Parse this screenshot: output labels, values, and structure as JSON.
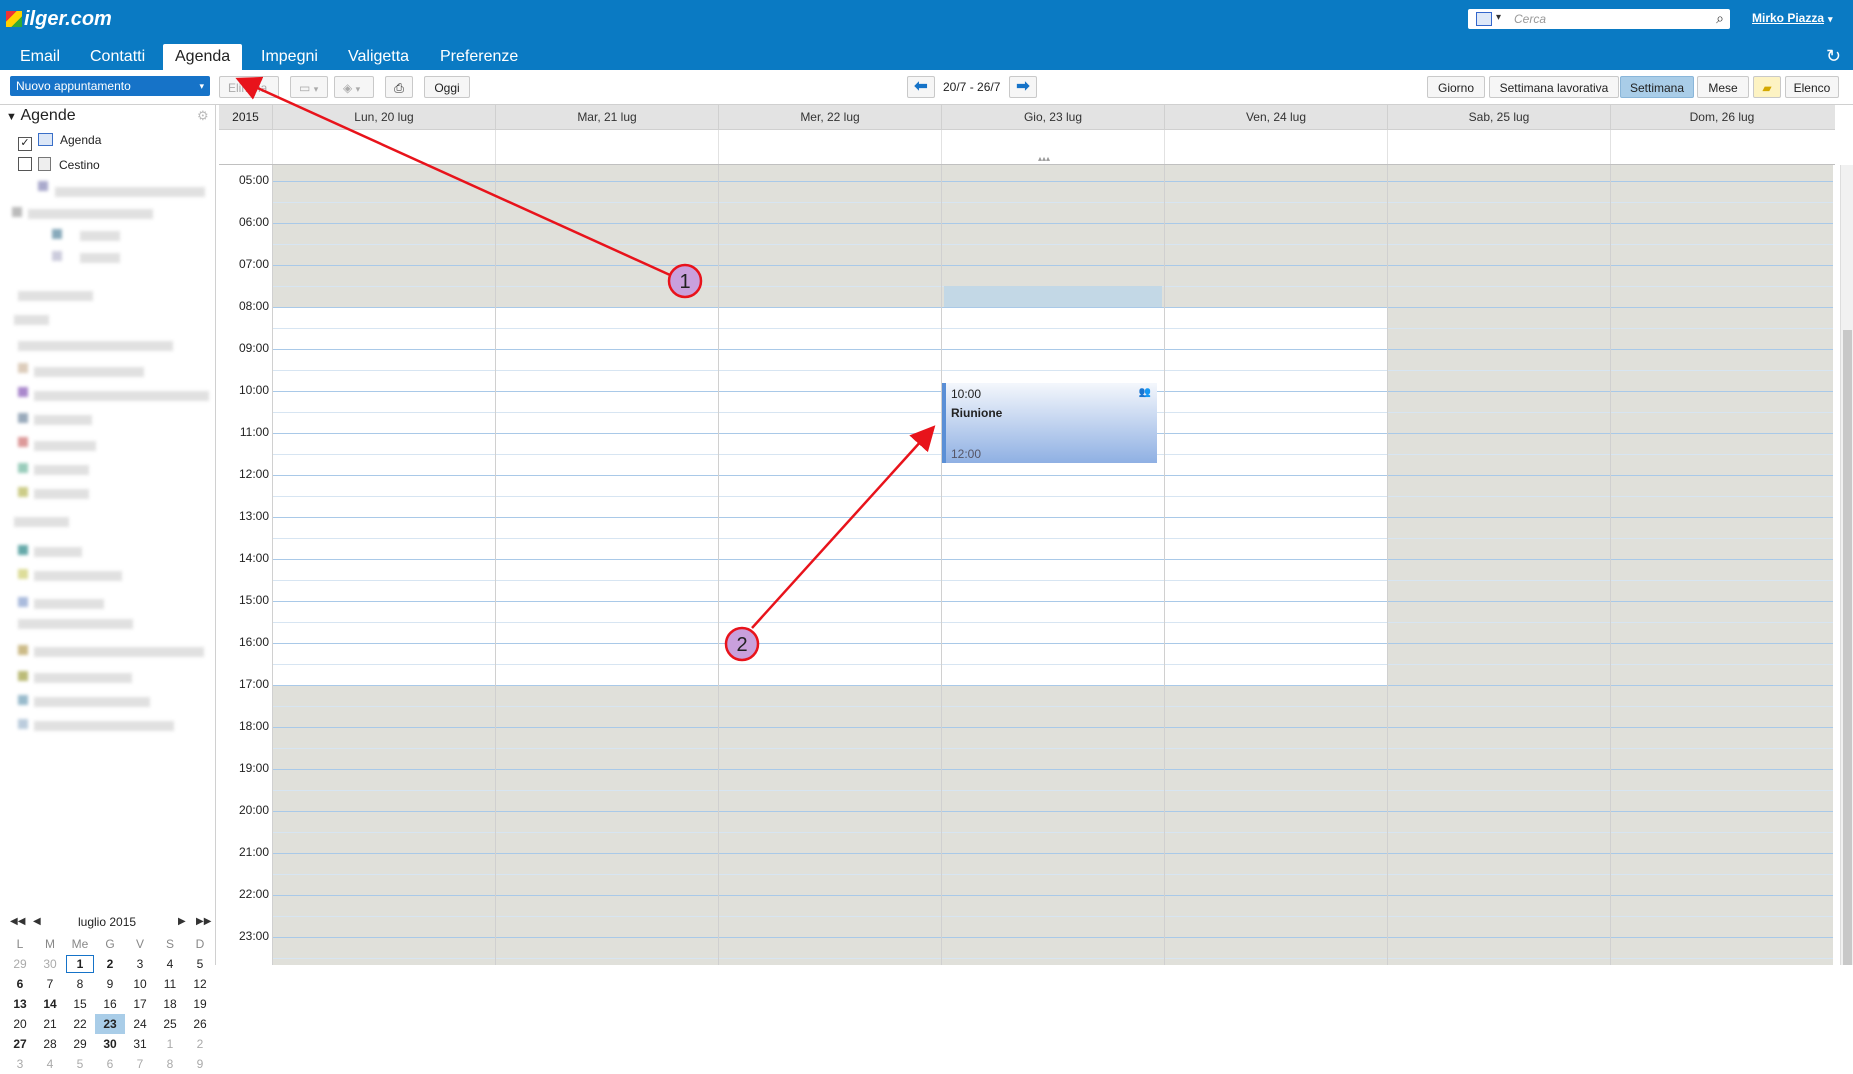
{
  "app": {
    "logo_text": "ilger.com",
    "user_name": "Mirko Piazza",
    "search_placeholder": "Cerca"
  },
  "nav_tabs": [
    {
      "label": "Email"
    },
    {
      "label": "Contatti"
    },
    {
      "label": "Agenda",
      "active": true
    },
    {
      "label": "Impegni"
    },
    {
      "label": "Valigetta"
    },
    {
      "label": "Preferenze"
    }
  ],
  "toolbar": {
    "new_appointment": "Nuovo appuntamento",
    "delete": "Elimina",
    "today": "Oggi",
    "date_range": "20/7 - 26/7",
    "views": [
      "Giorno",
      "Settimana lavorativa",
      "Settimana",
      "Mese",
      "Elenco"
    ],
    "selected_view": "Settimana"
  },
  "sidebar": {
    "section_title": "Agende",
    "calendars": [
      {
        "label": "Agenda",
        "checked": true
      },
      {
        "label": "Cestino",
        "checked": false
      }
    ]
  },
  "mini_calendar": {
    "month_label": "luglio 2015",
    "weekdays": [
      "L",
      "M",
      "Me",
      "G",
      "V",
      "S",
      "D"
    ],
    "weeks": [
      [
        "29",
        "30",
        "1",
        "2",
        "3",
        "4",
        "5"
      ],
      [
        "6",
        "7",
        "8",
        "9",
        "10",
        "11",
        "12"
      ],
      [
        "13",
        "14",
        "15",
        "16",
        "17",
        "18",
        "19"
      ],
      [
        "20",
        "21",
        "22",
        "23",
        "24",
        "25",
        "26"
      ],
      [
        "27",
        "28",
        "29",
        "30",
        "31",
        "1",
        "2"
      ],
      [
        "3",
        "4",
        "5",
        "6",
        "7",
        "8",
        "9"
      ]
    ],
    "today": "1",
    "selected": "23"
  },
  "week_view": {
    "year": "2015",
    "days": [
      "Lun, 20 lug",
      "Mar, 21 lug",
      "Mer, 22 lug",
      "Gio, 23 lug",
      "Ven, 24 lug",
      "Sab, 25 lug",
      "Dom, 26 lug"
    ],
    "hours": [
      "05:00",
      "06:00",
      "07:00",
      "08:00",
      "09:00",
      "10:00",
      "11:00",
      "12:00",
      "13:00",
      "14:00",
      "15:00",
      "16:00",
      "17:00",
      "18:00",
      "19:00",
      "20:00",
      "21:00",
      "22:00",
      "23:00"
    ]
  },
  "event": {
    "start": "10:00",
    "title": "Riunione",
    "end": "12:00",
    "day": "Gio, 23 lug"
  },
  "annotations": [
    {
      "label": "1"
    },
    {
      "label": "2"
    }
  ],
  "colors": {
    "brand": "#0a7ac3",
    "selected": "#a9cde8",
    "event_accent": "#5a8fd6",
    "annotation": "#e8131b"
  }
}
